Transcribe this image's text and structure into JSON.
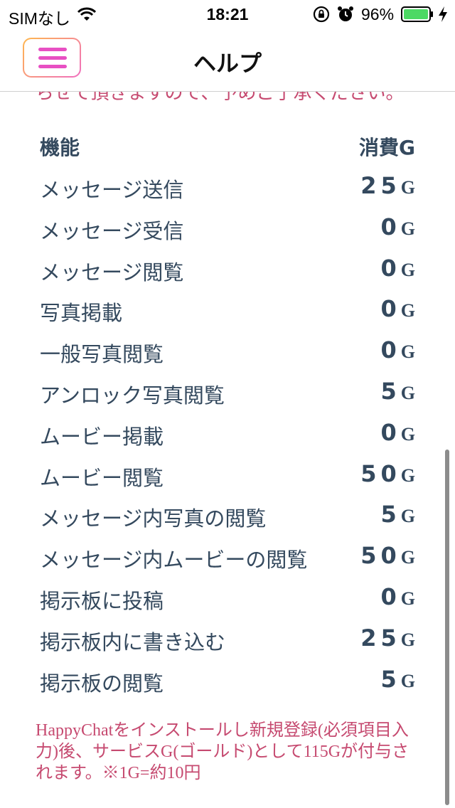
{
  "status_bar": {
    "carrier": "SIMなし",
    "time": "18:21",
    "battery_percent": "96%",
    "icons": [
      "wifi-icon",
      "rotation-lock-icon",
      "alarm-icon",
      "battery-icon",
      "charging-bolt-icon"
    ],
    "battery_color": "#4cd964"
  },
  "nav": {
    "title": "ヘルプ",
    "menu_icon": "hamburger-menu-icon",
    "menu_color": "#e84fc3"
  },
  "content": {
    "partial_top_text": "らせて頂きますので、予めご了承ください。",
    "table": {
      "header_function": "機能",
      "header_cost": "消費G",
      "rows": [
        {
          "function": "メッセージ送信",
          "cost": "25",
          "unit": "G"
        },
        {
          "function": "メッセージ受信",
          "cost": "0",
          "unit": "G"
        },
        {
          "function": "メッセージ閲覧",
          "cost": "0",
          "unit": "G"
        },
        {
          "function": "写真掲載",
          "cost": "0",
          "unit": "G"
        },
        {
          "function": "一般写真閲覧",
          "cost": "0",
          "unit": "G"
        },
        {
          "function": "アンロック写真閲覧",
          "cost": "5",
          "unit": "G"
        },
        {
          "function": "ムービー掲載",
          "cost": "0",
          "unit": "G"
        },
        {
          "function": "ムービー閲覧",
          "cost": "50",
          "unit": "G"
        },
        {
          "function": "メッセージ内写真の閲覧",
          "cost": "5",
          "unit": "G"
        },
        {
          "function": "メッセージ内ムービーの閲覧",
          "cost": "50",
          "unit": "G"
        },
        {
          "function": "掲示板に投稿",
          "cost": "0",
          "unit": "G"
        },
        {
          "function": "掲示板内に書き込む",
          "cost": "25",
          "unit": "G"
        },
        {
          "function": "掲示板の閲覧",
          "cost": "5",
          "unit": "G"
        }
      ]
    },
    "note": "HappyChatをインストールし新規登録(必須項目入力)後、サービスG(ゴールド)として115Gが付与されます。※1G=約10円",
    "text_color": "#34495e",
    "accent_color": "#c64a70"
  }
}
